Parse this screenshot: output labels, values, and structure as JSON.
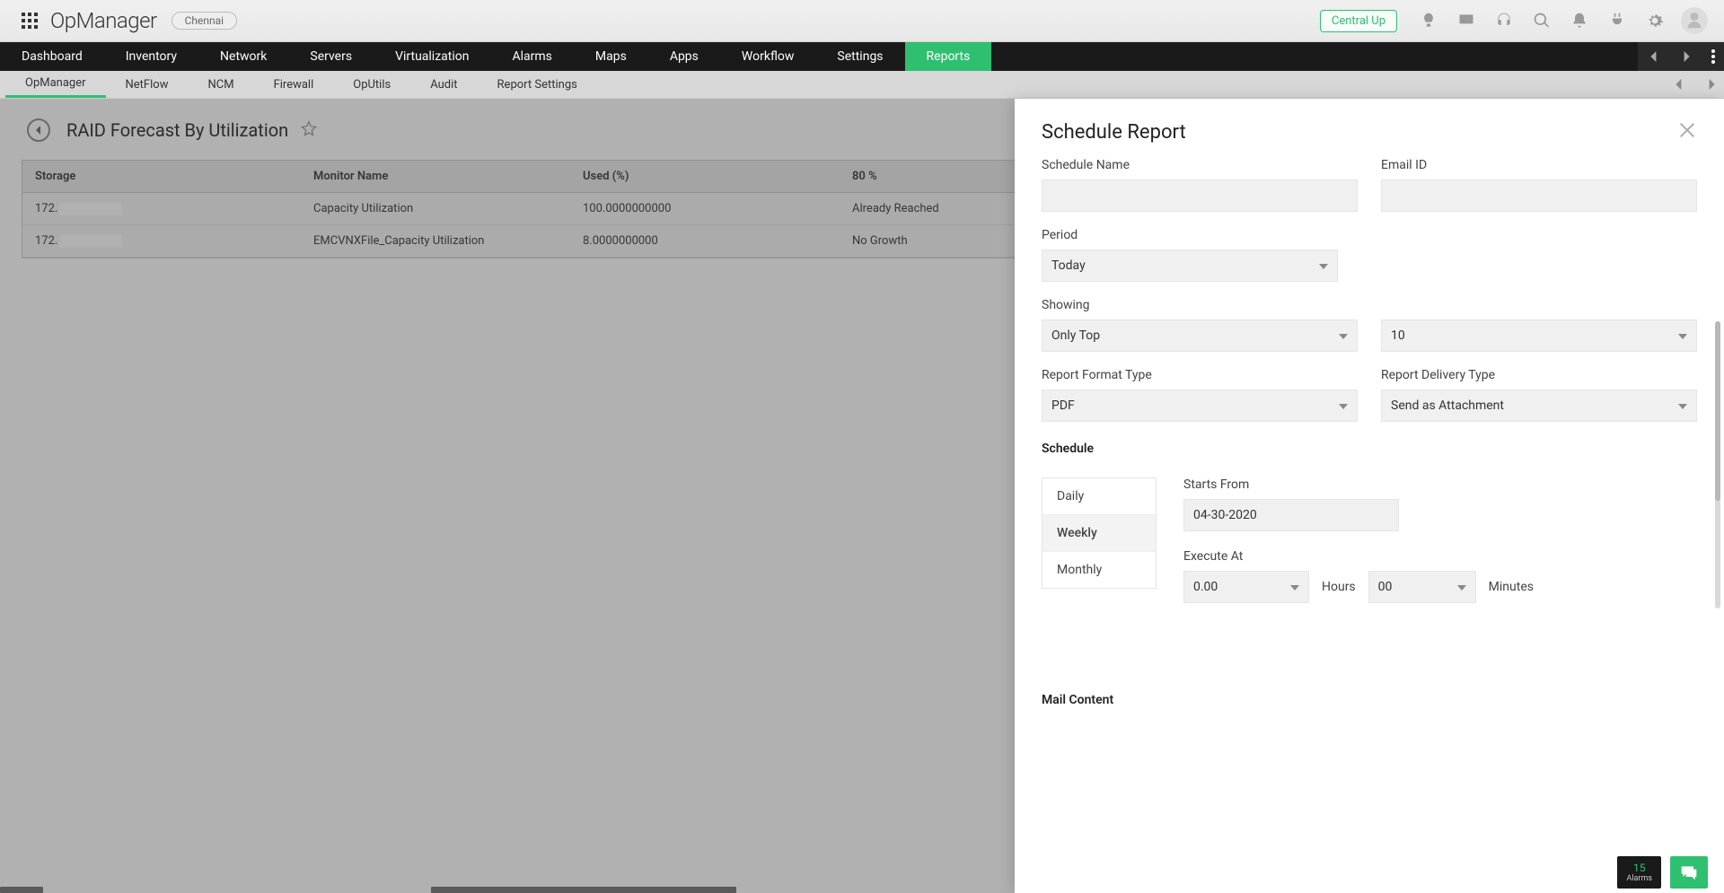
{
  "header": {
    "brand": "OpManager",
    "location": "Chennai",
    "central": "Central Up"
  },
  "main_nav": {
    "items": [
      "Dashboard",
      "Inventory",
      "Network",
      "Servers",
      "Virtualization",
      "Alarms",
      "Maps",
      "Apps",
      "Workflow",
      "Settings",
      "Reports"
    ],
    "active_index": 10
  },
  "sub_nav": {
    "items": [
      "OpManager",
      "NetFlow",
      "NCM",
      "Firewall",
      "OpUtils",
      "Audit",
      "Report Settings"
    ],
    "active_index": 0
  },
  "page": {
    "title": "RAID Forecast By Utilization"
  },
  "table": {
    "headers": {
      "storage": "Storage",
      "monitor": "Monitor Name",
      "used": "Used (%)",
      "eighty": "80 %"
    },
    "rows": [
      {
        "storage_prefix": "172.",
        "monitor": "Capacity Utilization",
        "used": "100.0000000000",
        "eighty": "Already Reached"
      },
      {
        "storage_prefix": "172.",
        "monitor": "EMCVNXFile_Capacity Utilization",
        "used": "8.0000000000",
        "eighty": "No Growth"
      }
    ]
  },
  "panel": {
    "title": "Schedule Report",
    "labels": {
      "schedule_name": "Schedule Name",
      "email_id": "Email ID",
      "period": "Period",
      "showing": "Showing",
      "report_format_type": "Report Format Type",
      "report_delivery_type": "Report Delivery Type",
      "schedule": "Schedule",
      "starts_from": "Starts From",
      "execute_at": "Execute At",
      "hours_unit": "Hours",
      "minutes_unit": "Minutes",
      "mail_content": "Mail Content"
    },
    "values": {
      "schedule_name": "",
      "email_id": "",
      "period": "Today",
      "showing": "Only Top",
      "showing_count": "10",
      "report_format_type": "PDF",
      "report_delivery_type": "Send as Attachment",
      "starts_from": "04-30-2020",
      "exec_hours": "0.00",
      "exec_minutes": "00"
    },
    "freq_tabs": [
      "Daily",
      "Weekly",
      "Monthly"
    ],
    "freq_selected": 1
  },
  "footer": {
    "alarm_count": "15",
    "alarm_label": "Alarms"
  }
}
